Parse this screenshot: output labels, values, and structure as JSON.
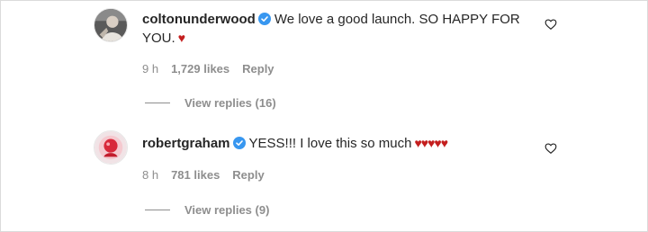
{
  "comments": [
    {
      "username": "coltonunderwood",
      "text_line1": "We love a good launch. SO HAPPY FOR",
      "text_line2": "YOU.",
      "hearts": "♥",
      "time": "9 h",
      "likes": "1,729 likes",
      "reply_label": "Reply",
      "view_replies": "View replies (16)",
      "avatar_icon": "profile-photo-icon"
    },
    {
      "username": "robertgraham",
      "text_line1": "YESS!!! I love this so much",
      "hearts": "♥♥♥♥♥",
      "time": "8 h",
      "likes": "781 likes",
      "reply_label": "Reply",
      "view_replies": "View replies (9)",
      "avatar_icon": "profile-photo-icon"
    }
  ],
  "icons": {
    "verified": "verified-badge-icon",
    "like": "heart-outline-icon"
  },
  "colors": {
    "verified": "#3897f0",
    "heart_emoji": "#c41e1e",
    "secondary_text": "#8e8e8e"
  }
}
